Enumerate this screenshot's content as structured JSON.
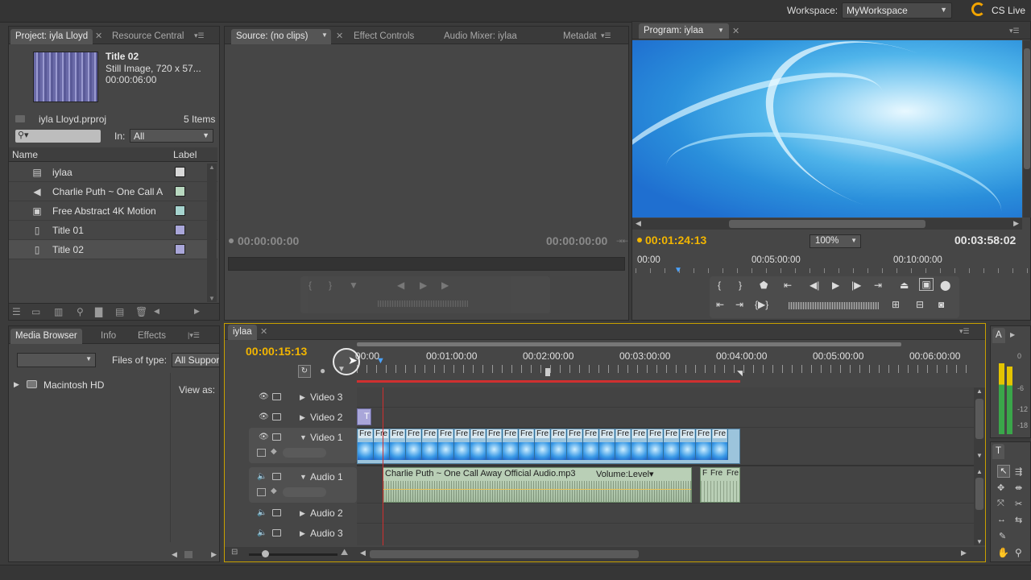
{
  "top_bar": {
    "workspace_label": "Workspace:",
    "workspace_value": "MyWorkspace",
    "cs_live": "CS Live"
  },
  "project_panel": {
    "tabs": [
      "Project: iyla Lloyd",
      "Resource Central"
    ],
    "preview": {
      "title": "Title 02",
      "line1": "Still Image, 720 x 57...",
      "line2": "00:00:06:00"
    },
    "project_file": "iyla Lloyd.prproj",
    "item_count": "5 Items",
    "in_label": "In:",
    "in_value": "All",
    "columns": {
      "name": "Name",
      "label": "Label"
    },
    "items": [
      {
        "name": "iylaa",
        "icon": "sequence-icon",
        "color": "#d8d8d8"
      },
      {
        "name": "Charlie Puth ~ One Call A",
        "icon": "audio-clip-icon",
        "color": "#b8d8c0"
      },
      {
        "name": "Free Abstract 4K Motion",
        "icon": "video-clip-icon",
        "color": "#a6d4cf"
      },
      {
        "name": "Title 01",
        "icon": "title-icon",
        "color": "#a9a6d9"
      },
      {
        "name": "Title 02",
        "icon": "title-icon",
        "color": "#a9a6d9"
      }
    ]
  },
  "source_panel": {
    "tabs": [
      "Source: (no clips)",
      "Effect Controls",
      "Audio Mixer: iylaa",
      "Metadat"
    ],
    "timecode_left": "00:00:00:00",
    "timecode_right": "00:00:00:00"
  },
  "program_panel": {
    "tab": "Program: iylaa",
    "timecode_current": "00:01:24:13",
    "zoom": "100%",
    "timecode_duration": "00:03:58:02",
    "ruler": [
      "00:00",
      "00:05:00:00",
      "00:10:00:00"
    ]
  },
  "media_browser": {
    "tabs": [
      "Media Browser",
      "Info",
      "Effects"
    ],
    "files_of_type_label": "Files of type:",
    "files_of_type_value": "All Suppor",
    "view_as": "View as:",
    "drive": "Macintosh HD"
  },
  "timeline": {
    "tab": "iylaa",
    "timecode": "00:00:15:13",
    "ruler": [
      "00:00",
      "00:01:00:00",
      "00:02:00:00",
      "00:03:00:00",
      "00:04:00:00",
      "00:05:00:00",
      "00:06:00:00"
    ],
    "tracks": {
      "video3": "Video 3",
      "video2": "Video 2",
      "video1": "Video 1",
      "audio1": "Audio 1",
      "audio2": "Audio 2",
      "audio3": "Audio 3"
    },
    "title_clip": "T",
    "video_clip_label": "Fre",
    "audio_clip_label": "Charlie Puth ~ One Call Away Official Audio.mp3",
    "audio_clip_fx": "Volume:Level",
    "audio_clip2_labels": [
      "F",
      "Fre",
      "Fre"
    ]
  },
  "meters": {
    "tab": "A",
    "scale": [
      "0",
      "-6",
      "-12",
      "-18"
    ]
  },
  "tools": {
    "tab": "T"
  },
  "colors": {
    "accent_timecode": "#f2b500",
    "video_clip": "#8fb7cf",
    "audio_clip": "#b9cfb6",
    "playhead": "#d03030"
  }
}
